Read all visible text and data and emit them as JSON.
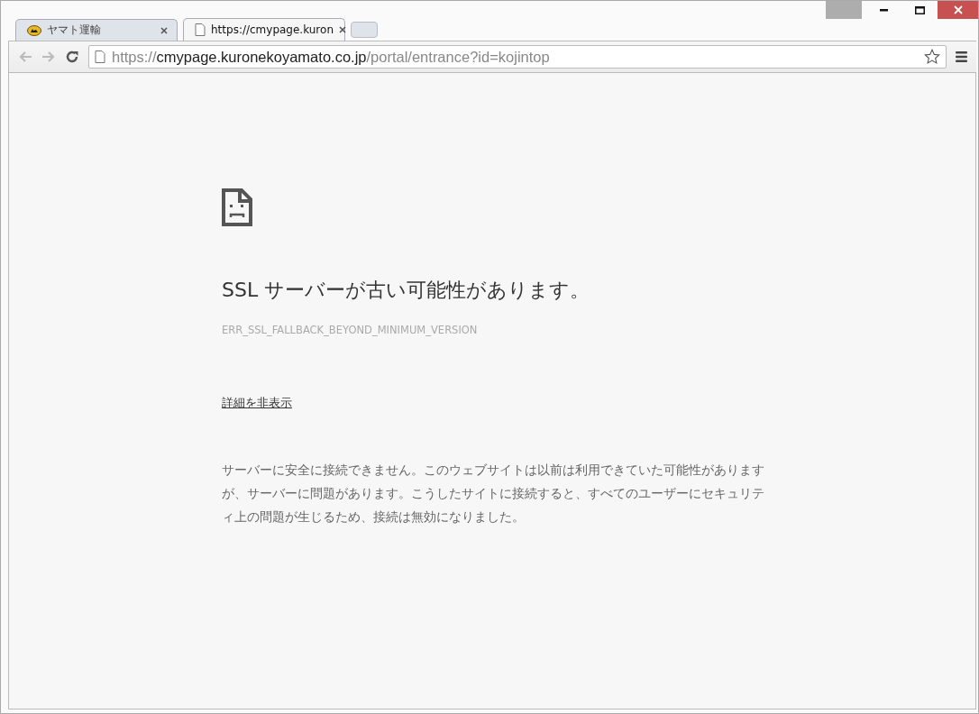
{
  "tabs": [
    {
      "title": "ヤマト運輸",
      "kind": "logo",
      "selected": false
    },
    {
      "title": "https://cmypage.kuron",
      "kind": "page",
      "selected": true
    }
  ],
  "address_bar": {
    "scheme": "https://",
    "host": "cmypage.kuronekoyamato.co.jp",
    "path": "/portal/entrance?id=kojintop"
  },
  "error": {
    "heading": "SSL サーバーが古い可能性があります。",
    "code": "ERR_SSL_FALLBACK_BEYOND_MINIMUM_VERSION",
    "details_link": "詳細を非表示",
    "message": "サーバーに安全に接続できません。このウェブサイトは以前は利用できていた可能性がありますが、サーバーに問題があります。こうしたサイトに接続すると、すべてのユーザーにセキュリティ上の問題が生じるため、接続は無効になりました。"
  }
}
